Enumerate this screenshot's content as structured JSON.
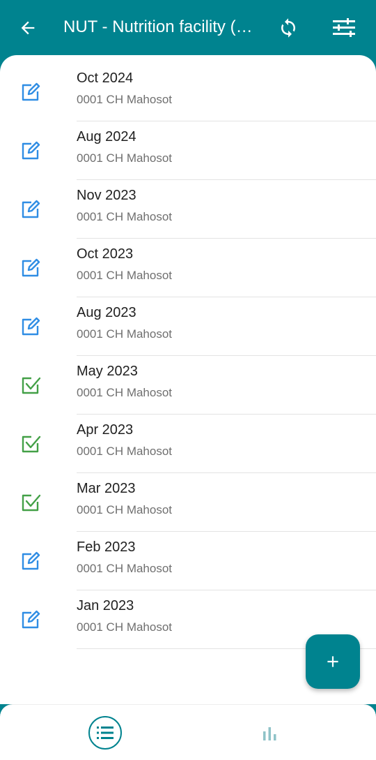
{
  "header": {
    "title": "NUT - Nutrition facility (…",
    "back_icon": "arrow-left-icon",
    "sync_icon": "sync-icon",
    "filter_icon": "filter-icon"
  },
  "colors": {
    "primary": "#00838f",
    "edit_icon": "#2f8de4",
    "complete_icon": "#43a047"
  },
  "events": [
    {
      "period": "Oct 2024",
      "org_unit": "0001 CH Mahosot",
      "status_icon": "edit-icon"
    },
    {
      "period": "Aug 2024",
      "org_unit": "0001 CH Mahosot",
      "status_icon": "edit-icon"
    },
    {
      "period": "Nov 2023",
      "org_unit": "0001 CH Mahosot",
      "status_icon": "edit-icon"
    },
    {
      "period": "Oct 2023",
      "org_unit": "0001 CH Mahosot",
      "status_icon": "edit-icon"
    },
    {
      "period": "Aug 2023",
      "org_unit": "0001 CH Mahosot",
      "status_icon": "edit-icon"
    },
    {
      "period": "May 2023",
      "org_unit": "0001 CH Mahosot",
      "status_icon": "completed-icon"
    },
    {
      "period": "Apr 2023",
      "org_unit": "0001 CH Mahosot",
      "status_icon": "completed-icon"
    },
    {
      "period": "Mar 2023",
      "org_unit": "0001 CH Mahosot",
      "status_icon": "completed-icon"
    },
    {
      "period": "Feb 2023",
      "org_unit": "0001 CH Mahosot",
      "status_icon": "edit-icon"
    },
    {
      "period": "Jan 2023",
      "org_unit": "0001 CH Mahosot",
      "status_icon": "edit-icon"
    }
  ],
  "fab": {
    "icon": "add-icon"
  },
  "bottom_nav": {
    "list_icon": "list-view-icon",
    "chart_icon": "bar-chart-icon",
    "active": "list"
  }
}
